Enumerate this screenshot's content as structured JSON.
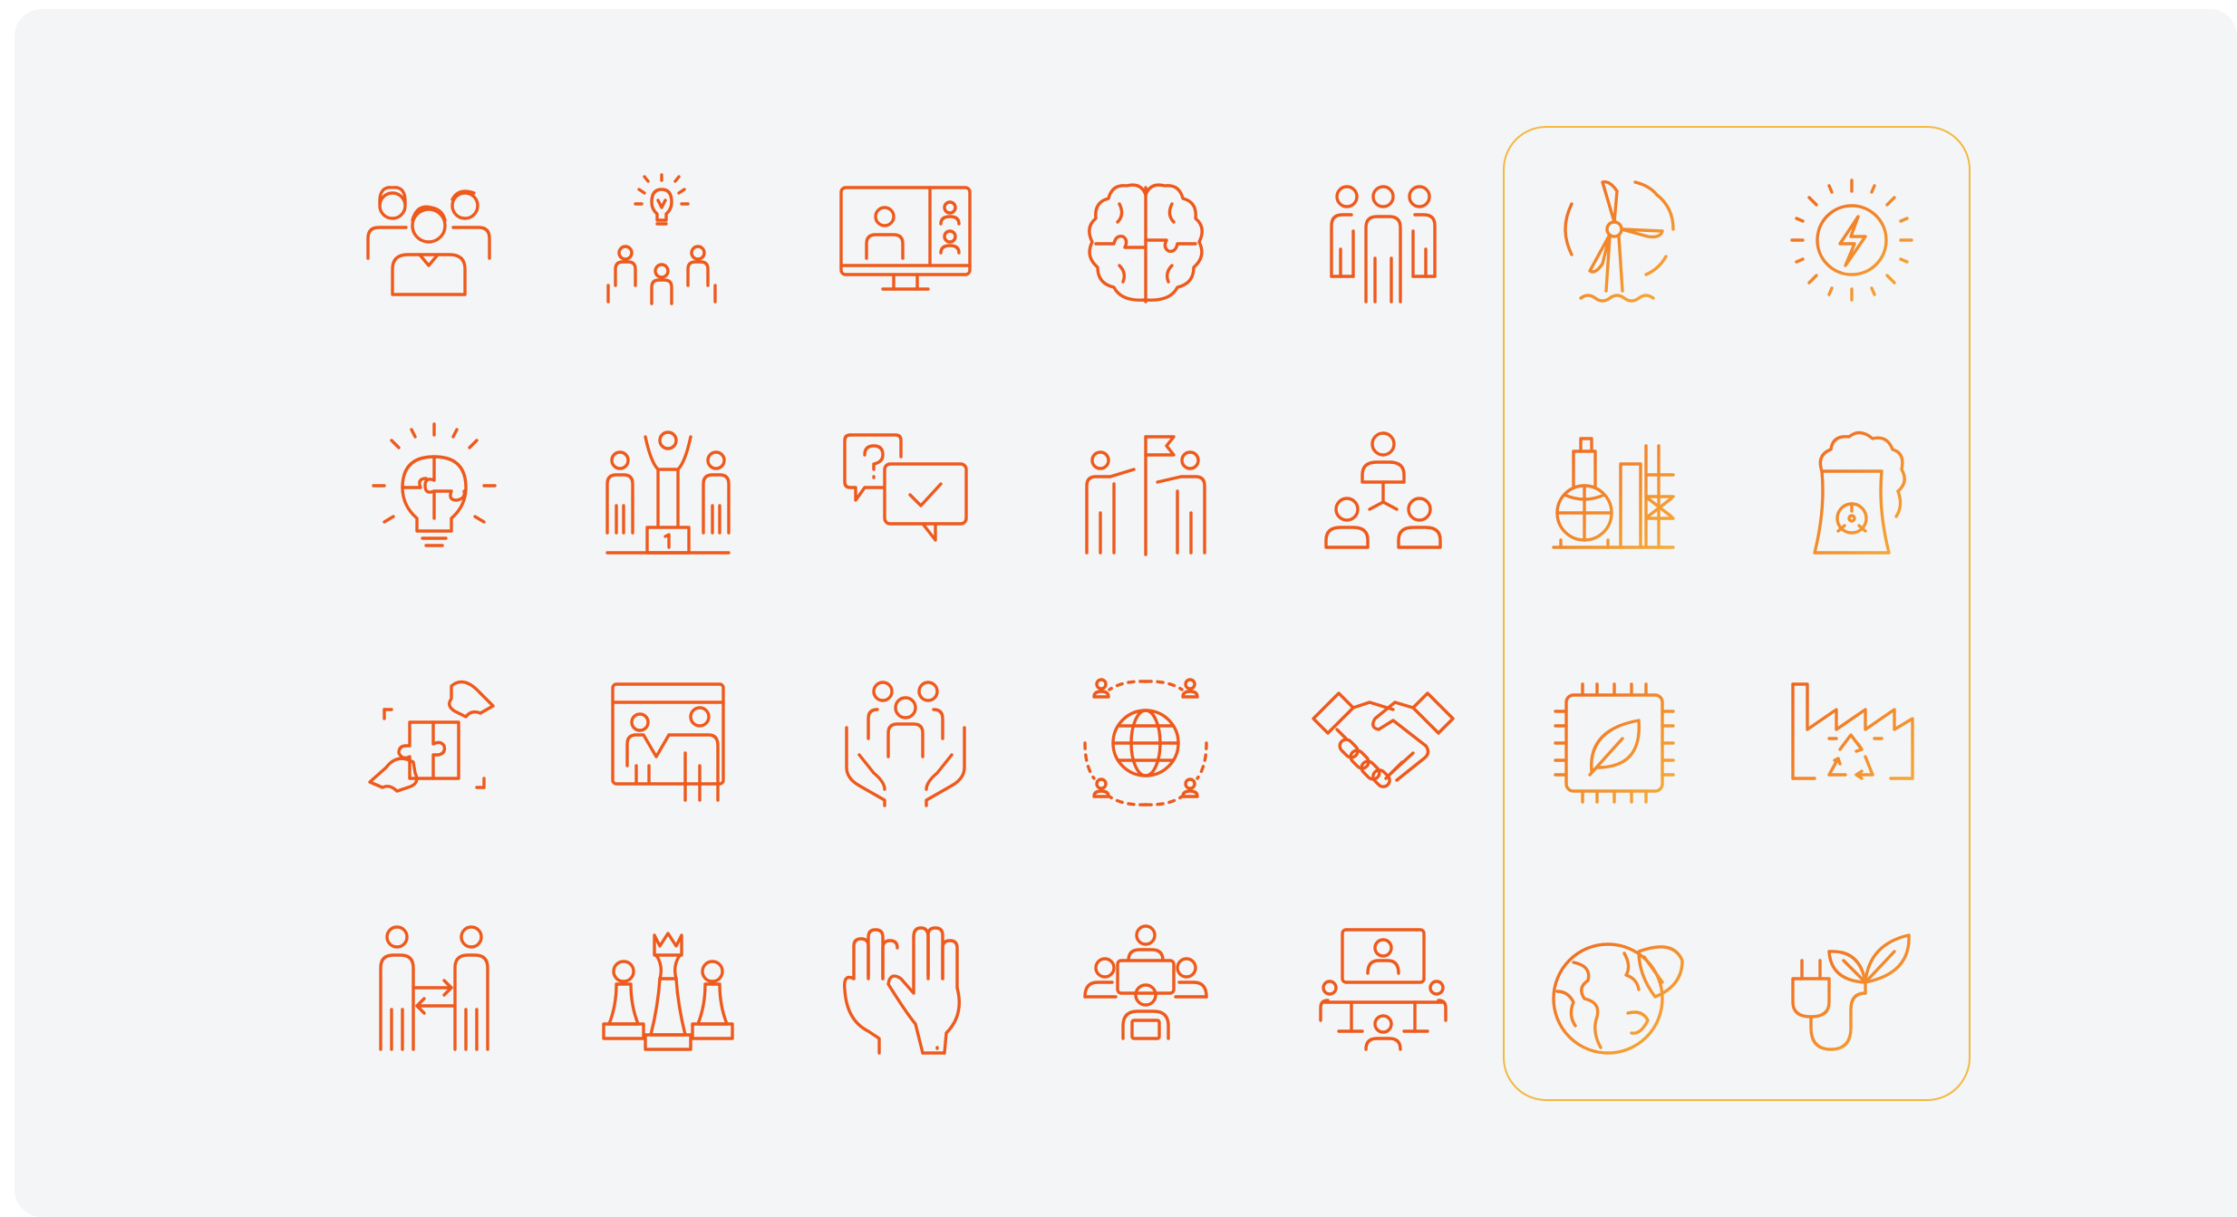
{
  "colors": {
    "background": "#f4f5f7",
    "icon_orange": "#ee5a1c",
    "gradient_start": "#ee5a1c",
    "gradient_end": "#f6b93c",
    "panel_border": "#f3b940"
  },
  "icon_grid": {
    "rows": 4,
    "columns": 7,
    "highlighted_columns": [
      6,
      7
    ],
    "icons": [
      "family-group-icon",
      "team-idea-icon",
      "video-conference-icon",
      "brain-puzzle-icon",
      "team-group-icon",
      "wind-turbine-icon",
      "solar-energy-icon",
      "idea-puzzle-bulb-icon",
      "winner-podium-icon",
      "question-answer-chat-icon",
      "goal-flag-team-icon",
      "hierarchy-team-icon",
      "industrial-plant-icon",
      "nuclear-plant-icon",
      "puzzle-hands-icon",
      "presentation-board-icon",
      "team-care-hands-icon",
      "global-network-icon",
      "handshake-icon",
      "eco-chip-icon",
      "recycling-factory-icon",
      "exchange-people-icon",
      "chess-strategy-icon",
      "raised-hands-icon",
      "meeting-table-icon",
      "video-meeting-table-icon",
      "eco-earth-icon",
      "eco-plug-icon"
    ]
  }
}
